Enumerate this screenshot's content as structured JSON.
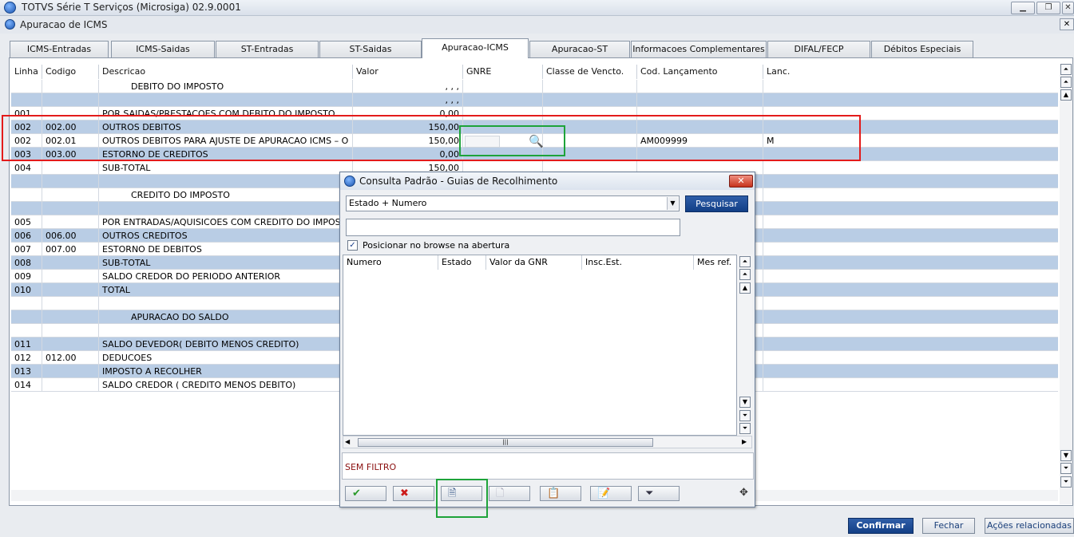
{
  "window": {
    "title": "TOTVS Série T Serviços (Microsiga) 02.9.0001",
    "subtitle": "Apuracao de ICMS"
  },
  "tabs": [
    "ICMS-Entradas",
    "ICMS-Saidas",
    "ST-Entradas",
    "ST-Saidas",
    "Apuracao-ICMS",
    "Apuracao-ST",
    "Informacoes Complementares",
    "DIFAL/FECP",
    "Débitos Especiais"
  ],
  "active_tab": "Apuracao-ICMS",
  "grid": {
    "columns": [
      "Linha",
      "Codigo",
      "Descricao",
      "Valor",
      "GNRE",
      "Classe de Vencto.",
      "Cod. Lançamento",
      "Lanc."
    ],
    "rows": [
      {
        "linha": "",
        "codigo": "",
        "descricao": "DEBITO DO IMPOSTO",
        "valor": ", , ,",
        "gnre": "",
        "classe": "",
        "cod": "",
        "lanc": ""
      },
      {
        "linha": "",
        "codigo": "",
        "descricao": "",
        "valor": ", , ,",
        "gnre": "",
        "classe": "",
        "cod": "",
        "lanc": ""
      },
      {
        "linha": "001",
        "codigo": "",
        "descricao": "POR SAIDAS/PRESTACOES COM DEBITO DO IMPOSTO",
        "valor": "0,00",
        "gnre": "",
        "classe": "",
        "cod": "",
        "lanc": ""
      },
      {
        "linha": "002",
        "codigo": "002.00",
        "descricao": "OUTROS DEBITOS",
        "valor": "150,00",
        "gnre": "",
        "classe": "",
        "cod": "",
        "lanc": ""
      },
      {
        "linha": "002",
        "codigo": "002.01",
        "descricao": "OUTROS DEBITOS PARA AJUSTE DE APURACAO ICMS – O",
        "valor": "150,00",
        "gnre": "",
        "classe": "",
        "cod": "AM009999",
        "lanc": "M"
      },
      {
        "linha": "003",
        "codigo": "003.00",
        "descricao": "ESTORNO DE CREDITOS",
        "valor": "0,00",
        "gnre": "",
        "classe": "",
        "cod": "",
        "lanc": ""
      },
      {
        "linha": "004",
        "codigo": "",
        "descricao": "SUB-TOTAL",
        "valor": "150,00",
        "gnre": "",
        "classe": "",
        "cod": "",
        "lanc": ""
      },
      {
        "linha": "",
        "codigo": "",
        "descricao": "",
        "valor": "",
        "gnre": "",
        "classe": "",
        "cod": "",
        "lanc": ""
      },
      {
        "linha": "",
        "codigo": "",
        "descricao": "CREDITO DO IMPOSTO",
        "valor": "",
        "gnre": "",
        "classe": "",
        "cod": "",
        "lanc": ""
      },
      {
        "linha": "",
        "codigo": "",
        "descricao": "",
        "valor": "",
        "gnre": "",
        "classe": "",
        "cod": "",
        "lanc": ""
      },
      {
        "linha": "005",
        "codigo": "",
        "descricao": "POR ENTRADAS/AQUISICOES COM CREDITO DO IMPOSTO",
        "valor": "",
        "gnre": "",
        "classe": "",
        "cod": "",
        "lanc": ""
      },
      {
        "linha": "006",
        "codigo": "006.00",
        "descricao": "OUTROS CREDITOS",
        "valor": "",
        "gnre": "",
        "classe": "",
        "cod": "",
        "lanc": ""
      },
      {
        "linha": "007",
        "codigo": "007.00",
        "descricao": "ESTORNO DE DEBITOS",
        "valor": "",
        "gnre": "",
        "classe": "",
        "cod": "",
        "lanc": ""
      },
      {
        "linha": "008",
        "codigo": "",
        "descricao": "SUB-TOTAL",
        "valor": "",
        "gnre": "",
        "classe": "",
        "cod": "",
        "lanc": ""
      },
      {
        "linha": "009",
        "codigo": "",
        "descricao": "SALDO CREDOR DO PERIODO ANTERIOR",
        "valor": "",
        "gnre": "",
        "classe": "",
        "cod": "",
        "lanc": ""
      },
      {
        "linha": "010",
        "codigo": "",
        "descricao": "TOTAL",
        "valor": "",
        "gnre": "",
        "classe": "",
        "cod": "",
        "lanc": ""
      },
      {
        "linha": "",
        "codigo": "",
        "descricao": "",
        "valor": "",
        "gnre": "",
        "classe": "",
        "cod": "",
        "lanc": ""
      },
      {
        "linha": "",
        "codigo": "",
        "descricao": "APURACAO DO SALDO",
        "valor": "",
        "gnre": "",
        "classe": "",
        "cod": "",
        "lanc": ""
      },
      {
        "linha": "",
        "codigo": "",
        "descricao": "",
        "valor": "",
        "gnre": "",
        "classe": "",
        "cod": "",
        "lanc": ""
      },
      {
        "linha": "011",
        "codigo": "",
        "descricao": "SALDO DEVEDOR( DEBITO MENOS CREDITO)",
        "valor": "",
        "gnre": "",
        "classe": "",
        "cod": "",
        "lanc": ""
      },
      {
        "linha": "012",
        "codigo": "012.00",
        "descricao": "DEDUCOES",
        "valor": "",
        "gnre": "",
        "classe": "",
        "cod": "",
        "lanc": ""
      },
      {
        "linha": "013",
        "codigo": "",
        "descricao": "IMPOSTO A RECOLHER",
        "valor": "",
        "gnre": "",
        "classe": "",
        "cod": "",
        "lanc": ""
      },
      {
        "linha": "014",
        "codigo": "",
        "descricao": "SALDO CREDOR ( CREDITO MENOS DEBITO)",
        "valor": "",
        "gnre": "",
        "classe": "",
        "cod": "",
        "lanc": ""
      }
    ]
  },
  "dialog": {
    "title": "Consulta Padrão - Guias de Recolhimento",
    "index_select": "Estado + Numero",
    "search_button": "Pesquisar",
    "search_value": "",
    "checkbox_label": "Posicionar no browse na abertura",
    "checkbox_checked": true,
    "columns": [
      "Numero",
      "Estado",
      "Valor da GNR",
      "Insc.Est.",
      "Mes ref."
    ],
    "filter_text": "SEM FILTRO",
    "toolbar_icons": [
      "ok-check-icon",
      "cancel-x-icon",
      "include-icon",
      "view-icon",
      "edit-icon",
      "edit2-icon",
      "filter-icon"
    ]
  },
  "buttons": {
    "confirm": "Confirmar",
    "close": "Fechar",
    "actions": "Ações relacionadas"
  },
  "colors": {
    "row_alt": "#b9cde5",
    "annotation_red": "#e31b1b",
    "annotation_green": "#1ea33a",
    "primary_button": "#1a4a96",
    "filter_text": "#8b1010"
  }
}
